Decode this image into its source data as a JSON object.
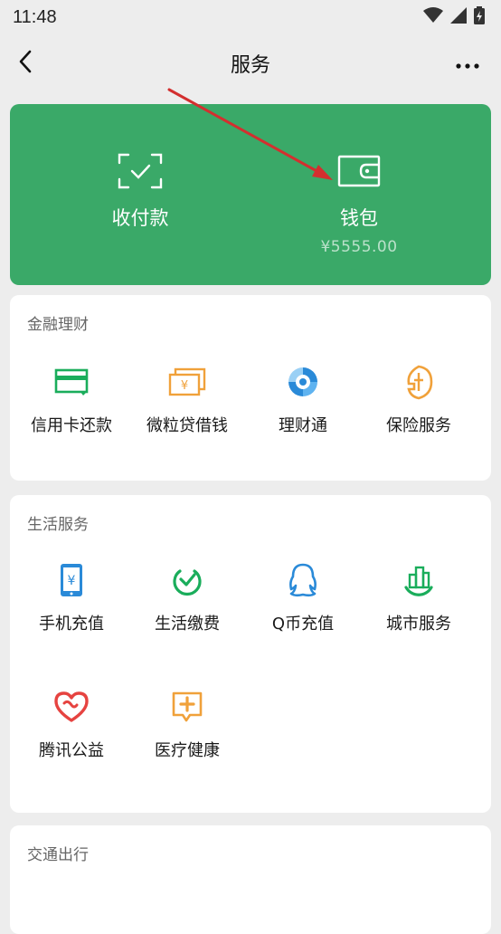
{
  "status_bar": {
    "time": "11:48",
    "icons": [
      "wifi-icon",
      "signal-icon",
      "battery-icon"
    ]
  },
  "nav": {
    "title": "服务",
    "back_icon": "chevron-left-icon",
    "more_icon": "more-dots-icon"
  },
  "top_card": {
    "background": "#3aa968",
    "items": [
      {
        "label": "收付款",
        "icon": "scan-pay-icon"
      },
      {
        "label": "钱包",
        "icon": "wallet-icon",
        "balance": "¥5555.00"
      }
    ]
  },
  "sections": [
    {
      "title": "金融理财",
      "items": [
        {
          "label": "信用卡还款",
          "icon": "credit-card-icon",
          "color": "#1aad5b"
        },
        {
          "label": "微粒贷借钱",
          "icon": "loan-icon",
          "color": "#f0a13a"
        },
        {
          "label": "理财通",
          "icon": "wealth-icon",
          "color": "#2a8ad8"
        },
        {
          "label": "保险服务",
          "icon": "insurance-icon",
          "color": "#f0a13a"
        }
      ]
    },
    {
      "title": "生活服务",
      "items": [
        {
          "label": "手机充值",
          "icon": "phone-topup-icon",
          "color": "#2a8ad8"
        },
        {
          "label": "生活缴费",
          "icon": "bill-pay-icon",
          "color": "#1aad5b"
        },
        {
          "label": "Q币充值",
          "icon": "qq-coin-icon",
          "color": "#2a8ad8"
        },
        {
          "label": "城市服务",
          "icon": "city-service-icon",
          "color": "#1aad5b"
        },
        {
          "label": "腾讯公益",
          "icon": "charity-icon",
          "color": "#e64340"
        },
        {
          "label": "医疗健康",
          "icon": "medical-icon",
          "color": "#f0a13a"
        }
      ]
    },
    {
      "title": "交通出行",
      "items": []
    }
  ],
  "annotation": {
    "arrow_color": "#d32f2f"
  }
}
